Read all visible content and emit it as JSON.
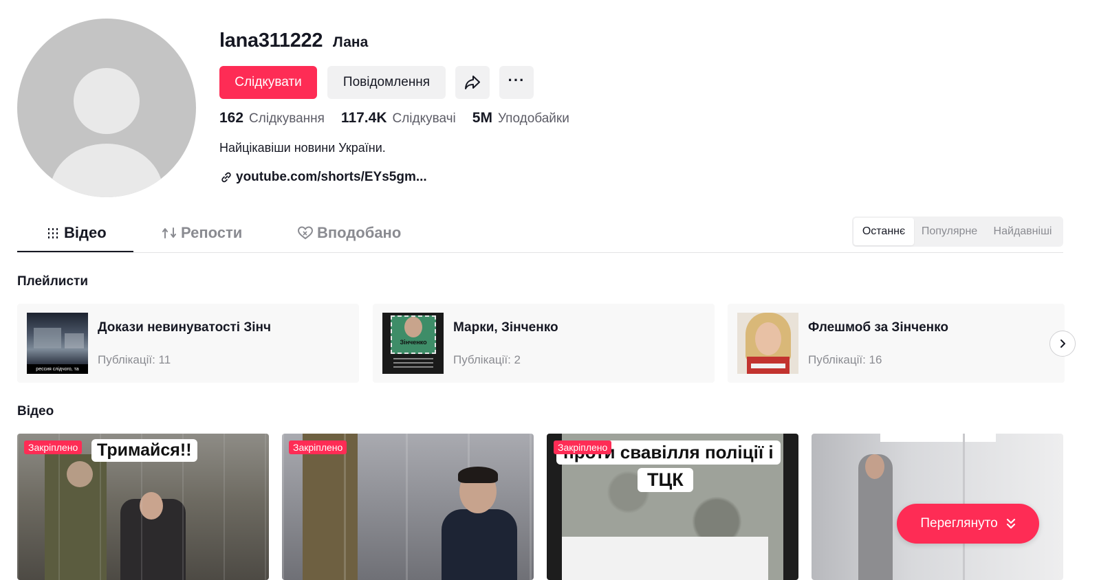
{
  "profile": {
    "username": "lana311222",
    "nickname": "Лана",
    "follow_label": "Слідкувати",
    "message_label": "Повідомлення",
    "stats": [
      {
        "num": "162",
        "label": "Слідкування"
      },
      {
        "num": "117.4K",
        "label": "Слідкувачі"
      },
      {
        "num": "5M",
        "label": "Уподобайки"
      }
    ],
    "bio": "Найцікавіши новини України.",
    "link": "youtube.com/shorts/EYs5gm..."
  },
  "tabs": [
    {
      "label": "Відео",
      "icon": "grid-icon",
      "active": true
    },
    {
      "label": "Репости",
      "icon": "repost-icon",
      "active": false
    },
    {
      "label": "Вподобано",
      "icon": "liked-heart-icon",
      "active": false
    }
  ],
  "sort": [
    "Останнє",
    "Популярне",
    "Найдавніші"
  ],
  "playlists_title": "Плейлисти",
  "playlists": [
    {
      "name": "Докази невинуватості Зінч",
      "count": "Публікації: 11",
      "thumb_caption": "рессия слідчого, та"
    },
    {
      "name": "Марки, Зінченко",
      "count": "Публікації: 2",
      "thumb_caption": "Зінченко"
    },
    {
      "name": "Флешмоб за Зінченко",
      "count": "Публікації: 16",
      "thumb_caption": ""
    }
  ],
  "videos_title": "Відео",
  "videos": [
    {
      "badge": "Закріплено",
      "overlay": "Тримайся!!"
    },
    {
      "badge": "Закріплено",
      "overlay": ""
    },
    {
      "badge": "Закріплено",
      "overlay_lines": [
        "проти свавілля поліції і",
        "ТЦК"
      ]
    },
    {
      "badge": "",
      "overlay": ""
    }
  ],
  "watched_label": "Переглянуто",
  "colors": {
    "accent": "#fe2c55",
    "text": "#161823",
    "muted": "#8a8b91",
    "button_bg": "#f1f1f2"
  }
}
